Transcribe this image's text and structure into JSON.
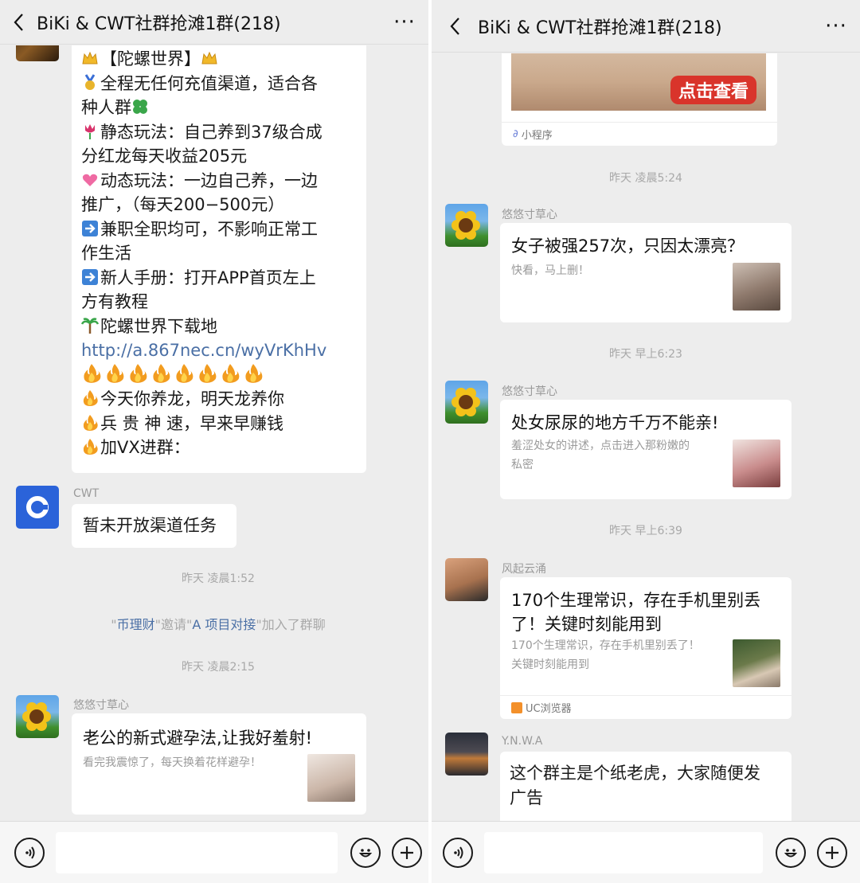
{
  "left": {
    "title": "BiKi & CWT社群抢滩1群(218)",
    "more": "···",
    "promo": {
      "line_1": "【陀螺世界】",
      "line_2": "全程无任何充值渠道，适合各",
      "line_3": "种人群",
      "line_4": "静态玩法：自己养到37级合成",
      "line_5": "分红龙每天收益205元",
      "line_6": "动态玩法：一边自己养，一边",
      "line_7": "推广，（每天200−500元）",
      "line_8": "兼职全职均可，不影响正常工",
      "line_9": "作生活",
      "line_10": "新人手册：打开APP首页左上",
      "line_11": "方有教程",
      "line_12": "陀螺世界下载地",
      "link": "http://a.867nec.cn/wyVrKhHv",
      "line_13": "今天你养龙，明天龙养你",
      "line_14": "兵 贵 神 速，早来早赚钱",
      "line_15": "加VX进群："
    },
    "cwt_sender": "CWT",
    "cwt_message": "暂未开放渠道任务",
    "time_1": "昨天 凌晨1:52",
    "system": {
      "inviter": "币理财",
      "verb": "邀请",
      "invitee": "A 项目对接",
      "suffix": "加入了群聊",
      "q1": "\"",
      "q2": "\""
    },
    "time_2": "昨天 凌晨2:15",
    "card_sender": "悠悠寸草心",
    "card_title": "老公的新式避孕法,让我好羞射!",
    "card_desc": "看完我震惊了，每天换着花样避孕！"
  },
  "right": {
    "title": "BiKi & CWT社群抢滩1群(218)",
    "more": "···",
    "mini_button": "点击查看",
    "mini_label": "小程序",
    "time_1": "昨天 凌晨5:24",
    "msg1": {
      "sender": "悠悠寸草心",
      "title": "女子被强257次，只因太漂亮？",
      "desc": "快看，马上删！"
    },
    "time_2": "昨天 早上6:23",
    "msg2": {
      "sender": "悠悠寸草心",
      "title": "处女尿尿的地方千万不能亲!",
      "desc_1": "羞涩处女的讲述，点击进入那粉嫩的",
      "desc_2": "私密"
    },
    "time_3": "昨天 早上6:39",
    "msg3": {
      "sender": "风起云涌",
      "title_1": "170个生理常识，存在手机里别丢",
      "title_2": "了！关键时刻能用到",
      "desc_1": "170个生理常识，存在手机里别丢了！",
      "desc_2": "关键时刻能用到",
      "source": "UC浏览器"
    },
    "msg4": {
      "sender": "Y.N.W.A",
      "text_1": "这个群主是个纸老虎，大家随便发",
      "text_2": "广告"
    }
  },
  "colors": {
    "background": "#ededed",
    "bubble": "#ffffff",
    "link": "#4a6fa5",
    "meta_text": "#a8a8a8",
    "cwt_brand": "#2b63d9",
    "mini_button": "#d9342b"
  },
  "icons": [
    "back-chevron-icon",
    "more-icon",
    "voice-icon",
    "emoji-icon",
    "plus-icon",
    "crown-icon",
    "medal-icon",
    "clover-icon",
    "tulip-icon",
    "heart-icon",
    "arrow-right-icon",
    "palm-icon",
    "flame-icon",
    "mini-program-icon",
    "uc-browser-icon"
  ]
}
